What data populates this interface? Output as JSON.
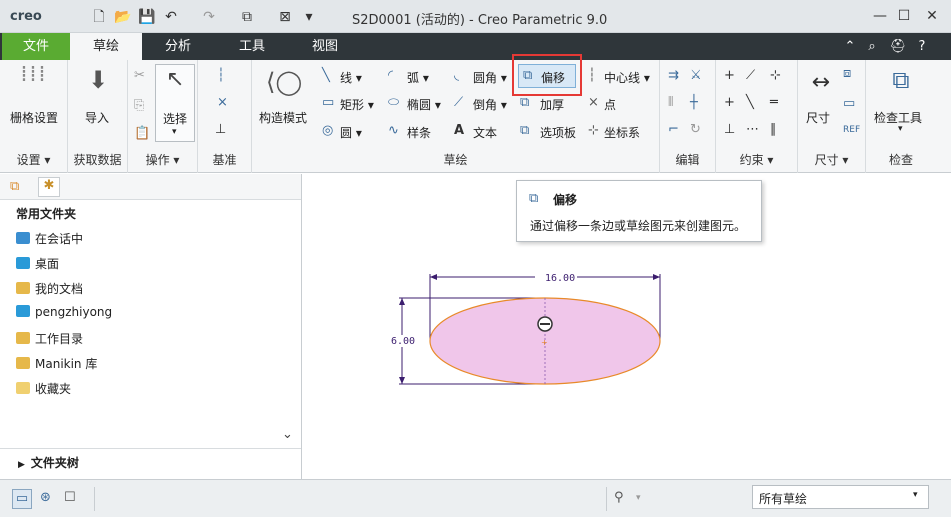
{
  "app": {
    "logo": "creo",
    "title": "S2D0001 (活动的) - Creo Parametric 9.0"
  },
  "quick_access": [
    "new-icon",
    "open-icon",
    "save-icon",
    "undo-icon",
    "redo-icon",
    "regenerate-icon",
    "close-window-icon",
    "customize-icon"
  ],
  "menu": {
    "tabs": [
      "文件",
      "草绘",
      "分析",
      "工具",
      "视图"
    ],
    "active": "草绘",
    "file_color": "#5aab32"
  },
  "ribbon": {
    "groups": {
      "setup": "设置",
      "get_data": "获取数据",
      "ops": "操作",
      "datum": "基准",
      "sketch": "草绘",
      "edit": "编辑",
      "constrain": "约束",
      "dimension": "尺寸",
      "inspect": "检查"
    },
    "buttons": {
      "grid": "栅格设置",
      "import": "导入",
      "select": "选择",
      "construct": "构造模式",
      "line": "线",
      "arc": "弧",
      "fillet": "圆角",
      "offset": "偏移",
      "centerline": "中心线",
      "rect": "矩形",
      "ellipse": "椭圆",
      "chamfer": "倒角",
      "thicken": "加厚",
      "point": "点",
      "circle": "圆",
      "spline": "样条",
      "text": "文本",
      "palette": "选项板",
      "coordsys": "坐标系",
      "dimension": "尺寸",
      "inspect": "检查工具"
    }
  },
  "tooltip": {
    "title": "偏移",
    "text": "通过偏移一条边或草绘图元来创建图元。"
  },
  "sidebar": {
    "header": "常用文件夹",
    "items": [
      "在会话中",
      "桌面",
      "我的文档",
      "pengzhiyong",
      "工作目录",
      "Manikin 库",
      "收藏夹"
    ],
    "footer": "文件夹树"
  },
  "sketch": {
    "width_dim": "16.00",
    "height_dim": "6.00",
    "fill": "#f0c6ea",
    "stroke": "#e88a2a",
    "dim_color": "#3b1d6e"
  },
  "status": {
    "filter": "所有草绘"
  },
  "colors": {
    "highlight": "#e53935",
    "accent": "#2f363a"
  }
}
